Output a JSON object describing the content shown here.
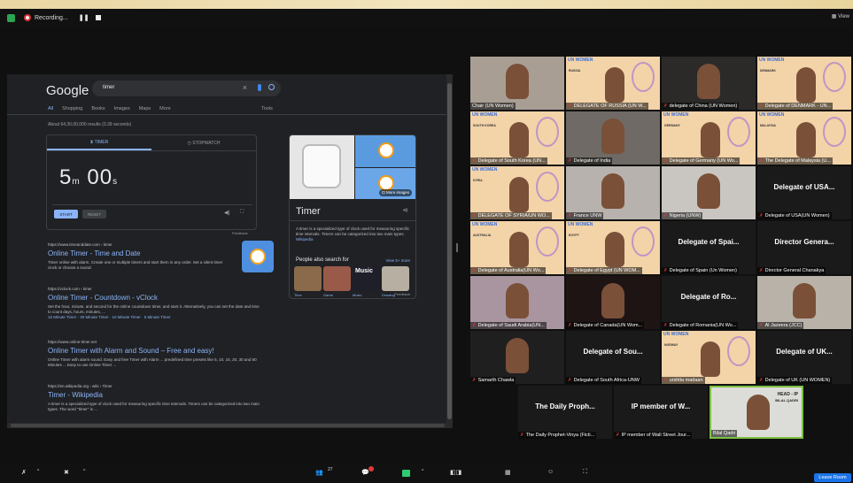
{
  "recording_bar": {
    "label": "Recording...",
    "pause_icon": "pause-icon",
    "stop_icon": "stop-icon"
  },
  "view_button": {
    "label": "View"
  },
  "shared_screen": {
    "google": {
      "logo": "Google",
      "query": "timer",
      "tabs": [
        "All",
        "Shopping",
        "Books",
        "Images",
        "Maps",
        "More"
      ],
      "tools": "Tools",
      "results_count": "About 64,30,00,000 results (0.39 seconds)",
      "timer_widget": {
        "tab_timer": "TIMER",
        "tab_stopwatch": "STOPWATCH",
        "minutes": "5",
        "minutes_unit": "m",
        "seconds": "00",
        "seconds_unit": "s",
        "start": "START",
        "reset": "RESET",
        "feedback": "Feedback"
      },
      "results": [
        {
          "url": "https://www.timeanddate.com › timer",
          "title": "Online Timer - Time and Date",
          "snippet": "Timer online with alarm. Create one or multiple timers and start them in any order. Set a silent timer clock or choose a sound.",
          "extra": ""
        },
        {
          "url": "https://vclock.com › timer",
          "title": "Online Timer - Countdown - vClock",
          "snippet": "Set the hour, minute, and second for the online countdown timer, and start it. Alternatively, you can set the date and time to count days, hours, minutes, ...",
          "extra": "15 Minute Timer · 30 Minute Timer · 10 Minute Timer · 5 Minute Timer"
        },
        {
          "url": "https://www.online-timer.net",
          "title": "Online Timer with Alarm and Sound – Free and easy!",
          "snippet": "Online Timer with alarm sound. Easy and free Timer with Alarm ... predefined time presets like 5, 10, 15, 20, 30 and 60 Minutes ... Easy to use Online Timer ...",
          "extra": ""
        },
        {
          "url": "https://en.wikipedia.org › wiki › Timer",
          "title": "Timer - Wikipedia",
          "snippet": "A timer is a specialized type of clock used for measuring specific time intervals. Timers can be categorized into two main types. The word \"timer\" is ...",
          "extra": ""
        }
      ],
      "knowledge_panel": {
        "more_images": "More images",
        "title": "Timer",
        "description": "A timer is a specialized type of clock used for measuring specific time intervals. Timers can be categorized into two main types.",
        "wiki_link": "Wikipedia",
        "people_also_search": "People also search for",
        "view_more": "View 5+ more",
        "items": [
          {
            "label": "Time",
            "color": "#8a6a4a"
          },
          {
            "label": "Game",
            "color": "#9a5a4a"
          },
          {
            "label": "Music",
            "color": "#1f1f2a"
          },
          {
            "label": "Drawing",
            "color": "#b7b0a2"
          }
        ],
        "music_overlay": "Music",
        "feedback": "Feedback"
      }
    }
  },
  "participants": [
    {
      "name": "Chair (UN Women)",
      "type": "video",
      "bg": "#a89e94",
      "muted": false
    },
    {
      "name": "DELEGATE OF RUSSIA (UN W...",
      "type": "banner",
      "banner_text": "RUSSIA",
      "muted": true
    },
    {
      "name": "delegate of China (UN Women)",
      "type": "video",
      "bg": "#2c2a28",
      "muted": true
    },
    {
      "name": "Delegate of DENMARK - UN...",
      "type": "banner",
      "banner_text": "DENMARK",
      "muted": true
    },
    {
      "name": "Delegate of South Korea (UN...",
      "type": "banner",
      "banner_text": "SOUTH KOREA",
      "muted": true
    },
    {
      "name": "Delegate of India",
      "type": "video",
      "bg": "#6f6a65",
      "muted": true
    },
    {
      "name": "Delegate of Germany (UN Wo...",
      "type": "banner",
      "banner_text": "GERMANY",
      "muted": true
    },
    {
      "name": "The Delegate of Malaysia (U...",
      "type": "banner",
      "banner_text": "MALAYSIA",
      "muted": true
    },
    {
      "name": "DELEGATE OF SYRIA/UN WO...",
      "type": "banner",
      "banner_text": "SYRIA",
      "muted": true
    },
    {
      "name": "France UNW",
      "type": "video",
      "bg": "#b7b2ad",
      "muted": true
    },
    {
      "name": "Nigeria (UNW)",
      "type": "video",
      "bg": "#c9c6c2",
      "muted": true
    },
    {
      "name": "Delegate of USA(UN Women)",
      "type": "name",
      "display": "Delegate of USA...",
      "muted": true
    },
    {
      "name": "Delegate of Australia(UN Wo...",
      "type": "banner",
      "banner_text": "AUSTRALIA",
      "muted": true
    },
    {
      "name": "Delegate of Egypt (UN WOM...",
      "type": "banner",
      "banner_text": "EGYPT",
      "muted": true
    },
    {
      "name": "Delegate of Spain (Un Women)",
      "type": "name",
      "display": "Delegate of Spai...",
      "muted": true
    },
    {
      "name": "Director General Chanakya",
      "type": "name",
      "display": "Director Genera...",
      "muted": true
    },
    {
      "name": "Delegate of Saudi Arabia(UN...",
      "type": "video",
      "bg": "#a895a0",
      "muted": true
    },
    {
      "name": "Delegate of Canada(UN Wom...",
      "type": "video",
      "bg": "#1e1414",
      "muted": true
    },
    {
      "name": "Delegate of Romania(UN Wo...",
      "type": "name",
      "display": "Delegate of Ro...",
      "muted": true
    },
    {
      "name": "Al Jazeera (JCC)",
      "type": "video",
      "bg": "#b9b2a8",
      "muted": true
    },
    {
      "name": "Samarth Chawla",
      "type": "video",
      "bg": "#1f1f1f",
      "muted": true
    },
    {
      "name": "Delegate of South Africa-UNW",
      "type": "name",
      "display": "Delegate of Sou...",
      "muted": true
    },
    {
      "name": "urshita madaan",
      "type": "banner",
      "banner_text": "NORWAY",
      "muted": true
    },
    {
      "name": "Delegate of UK (UN WOMEN)",
      "type": "name",
      "display": "Delegate of UK...",
      "muted": true
    },
    {
      "name": "The Daily Prophet-Vinya (Ficti...",
      "type": "name",
      "display": "The Daily Proph...",
      "muted": true
    },
    {
      "name": "IP member of Wall Street Jour...",
      "type": "name",
      "display": "IP member of W...",
      "muted": true
    },
    {
      "name": "Bilal Qadri",
      "type": "active",
      "bg": "#dcdcd8",
      "muted": false,
      "overlay": "HEAD - IP",
      "overlay2": "BILAL QADRI"
    }
  ],
  "unwomen_logo": "UN WOMEN",
  "toolbar": {
    "participants_count": "27",
    "leave": "Leave Room"
  }
}
